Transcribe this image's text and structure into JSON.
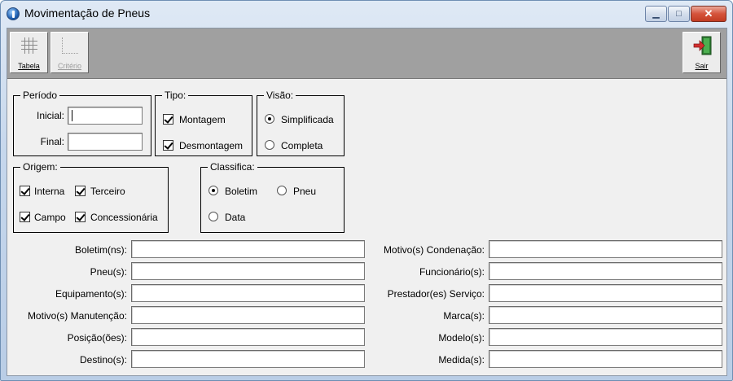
{
  "window": {
    "title": "Movimentação de Pneus",
    "minimize": "▁",
    "maximize": "□",
    "close": "✕"
  },
  "toolbar": {
    "tabela": {
      "label": "Tabela",
      "icon": "grid-icon"
    },
    "criterio": {
      "label": "Critério",
      "icon": "criteria-icon"
    },
    "sair": {
      "label": "Sair",
      "icon": "exit-door-icon"
    }
  },
  "periodo": {
    "legend": "Período",
    "inicial_label": "Inicial:",
    "inicial_value": "",
    "final_label": "Final:",
    "final_value": ""
  },
  "tipo": {
    "legend": "Tipo:",
    "montagem": "Montagem",
    "montagem_checked": true,
    "desmontagem": "Desmontagem",
    "desmontagem_checked": true
  },
  "visao": {
    "legend": "Visão:",
    "simplificada": "Simplificada",
    "completa": "Completa",
    "selected": "Simplificada"
  },
  "origem": {
    "legend": "Origem:",
    "interna": "Interna",
    "terceiro": "Terceiro",
    "campo": "Campo",
    "concessionaria": "Concessionária",
    "interna_checked": true,
    "terceiro_checked": true,
    "campo_checked": true,
    "concessionaria_checked": true
  },
  "classifica": {
    "legend": "Classifica:",
    "boletim": "Boletim",
    "pneu": "Pneu",
    "data": "Data",
    "selected": "Boletim"
  },
  "filters_left": [
    {
      "label": "Boletim(ns):",
      "value": ""
    },
    {
      "label": "Pneu(s):",
      "value": ""
    },
    {
      "label": "Equipamento(s):",
      "value": ""
    },
    {
      "label": "Motivo(s) Manutenção:",
      "value": ""
    },
    {
      "label": "Posição(ões):",
      "value": ""
    },
    {
      "label": "Destino(s):",
      "value": ""
    }
  ],
  "filters_right": [
    {
      "label": "Motivo(s) Condenação:",
      "value": ""
    },
    {
      "label": "Funcionário(s):",
      "value": ""
    },
    {
      "label": "Prestador(es) Serviço:",
      "value": ""
    },
    {
      "label": "Marca(s):",
      "value": ""
    },
    {
      "label": "Modelo(s):",
      "value": ""
    },
    {
      "label": "Medida(s):",
      "value": ""
    }
  ]
}
